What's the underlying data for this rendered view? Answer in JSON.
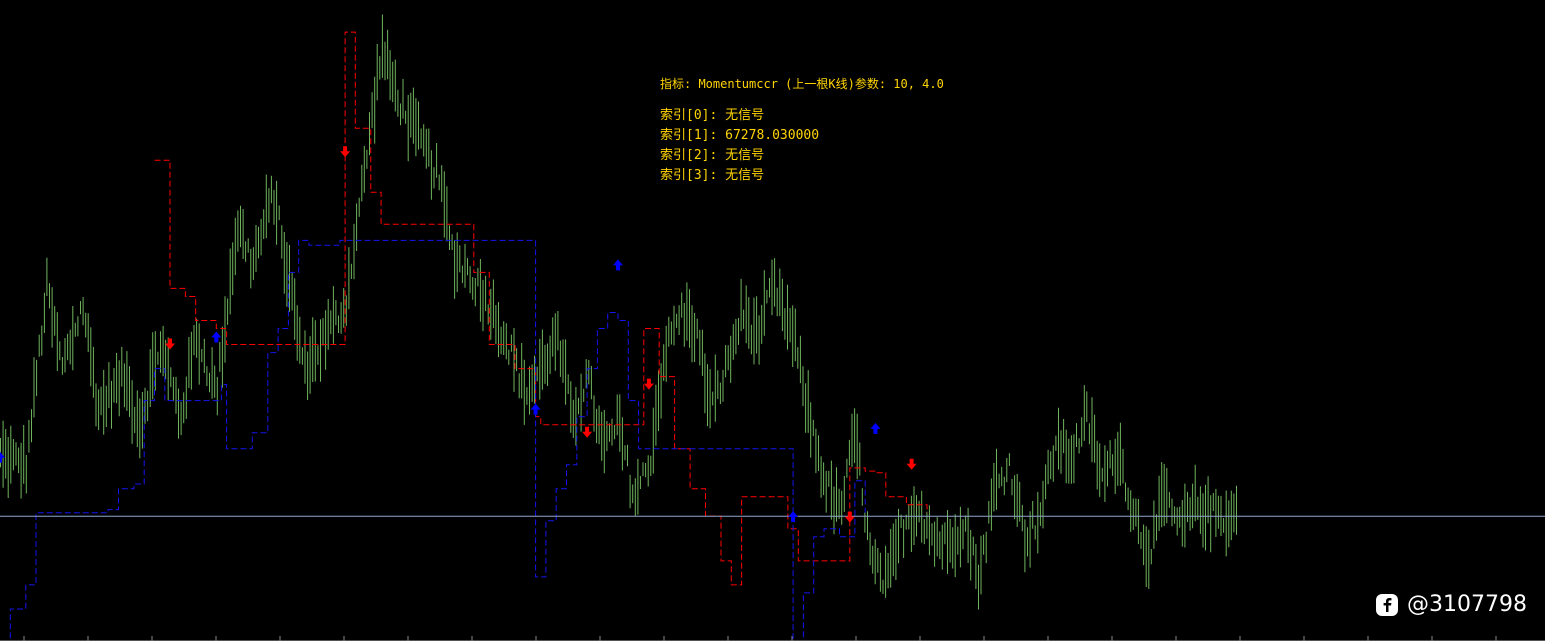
{
  "chart_data": {
    "type": "candlestick",
    "indicator_header": "指标: Momentumccr (上一根K线)参数: 10, 4.0",
    "buffers": [
      "索引[0]: 无信号",
      "索引[1]: 67278.030000",
      "索引[2]: 无信号",
      "索引[3]: 无信号"
    ],
    "horizontal_line": 67278.03,
    "ylim": [
      66500,
      70500
    ],
    "xlim": [
      0,
      240
    ],
    "price_anchors": [
      [
        0,
        67650
      ],
      [
        5,
        67600
      ],
      [
        9,
        68700
      ],
      [
        12,
        68200
      ],
      [
        16,
        68600
      ],
      [
        19,
        67950
      ],
      [
        24,
        68150
      ],
      [
        27,
        67850
      ],
      [
        31,
        68350
      ],
      [
        35,
        67900
      ],
      [
        38,
        68400
      ],
      [
        42,
        68050
      ],
      [
        46,
        69100
      ],
      [
        49,
        68850
      ],
      [
        53,
        69300
      ],
      [
        56,
        68750
      ],
      [
        59,
        68200
      ],
      [
        63,
        68400
      ],
      [
        67,
        68600
      ],
      [
        71,
        69500
      ],
      [
        74,
        70200
      ],
      [
        77,
        69900
      ],
      [
        81,
        69650
      ],
      [
        85,
        69400
      ],
      [
        88,
        68900
      ],
      [
        91,
        68800
      ],
      [
        95,
        68600
      ],
      [
        98,
        68400
      ],
      [
        102,
        68050
      ],
      [
        105,
        68200
      ],
      [
        108,
        68400
      ],
      [
        111,
        67900
      ],
      [
        114,
        68150
      ],
      [
        117,
        67700
      ],
      [
        120,
        67850
      ],
      [
        123,
        67400
      ],
      [
        126,
        67600
      ],
      [
        129,
        68300
      ],
      [
        132,
        68550
      ],
      [
        135,
        68450
      ],
      [
        138,
        67950
      ],
      [
        141,
        68200
      ],
      [
        144,
        68550
      ],
      [
        147,
        68400
      ],
      [
        150,
        68700
      ],
      [
        154,
        68400
      ],
      [
        157,
        67900
      ],
      [
        160,
        67500
      ],
      [
        163,
        67300
      ],
      [
        166,
        67800
      ],
      [
        169,
        67000
      ],
      [
        172,
        66850
      ],
      [
        175,
        67200
      ],
      [
        178,
        67350
      ],
      [
        181,
        67150
      ],
      [
        184,
        67100
      ],
      [
        187,
        67250
      ],
      [
        190,
        66900
      ],
      [
        193,
        67450
      ],
      [
        196,
        67600
      ],
      [
        199,
        67150
      ],
      [
        202,
        67300
      ],
      [
        205,
        67750
      ],
      [
        208,
        67650
      ],
      [
        211,
        67900
      ],
      [
        214,
        67500
      ],
      [
        217,
        67700
      ],
      [
        220,
        67300
      ],
      [
        223,
        67050
      ],
      [
        226,
        67400
      ],
      [
        229,
        67200
      ],
      [
        232,
        67350
      ],
      [
        235,
        67300
      ],
      [
        238,
        67280
      ],
      [
        240,
        67280
      ]
    ],
    "upper_stop": [
      [
        30,
        69500
      ],
      [
        33,
        68700
      ],
      [
        36,
        68650
      ],
      [
        38,
        68500
      ],
      [
        42,
        68450
      ],
      [
        44,
        68350
      ],
      [
        67,
        70300
      ],
      [
        69,
        69700
      ],
      [
        72,
        69300
      ],
      [
        74,
        69100
      ],
      [
        89,
        69100
      ],
      [
        92,
        68800
      ],
      [
        95,
        68350
      ],
      [
        100,
        68200
      ],
      [
        104,
        67900
      ],
      [
        105,
        67850
      ],
      [
        125,
        68450
      ],
      [
        128,
        68150
      ],
      [
        131,
        67700
      ],
      [
        134,
        67450
      ],
      [
        137,
        67280
      ],
      [
        140,
        67000
      ],
      [
        142,
        66850
      ],
      [
        144,
        67400
      ],
      [
        153,
        67200
      ],
      [
        155,
        67000
      ],
      [
        165,
        67580
      ],
      [
        168,
        67560
      ],
      [
        170,
        67550
      ],
      [
        172,
        67400
      ],
      [
        176,
        67350
      ],
      [
        180,
        67300
      ]
    ],
    "lower_stop": [
      [
        0,
        66300
      ],
      [
        2,
        66700
      ],
      [
        5,
        66850
      ],
      [
        7,
        67300
      ],
      [
        21,
        67320
      ],
      [
        23,
        67450
      ],
      [
        26,
        67480
      ],
      [
        28,
        68000
      ],
      [
        30,
        68200
      ],
      [
        32,
        68000
      ],
      [
        42,
        68000
      ],
      [
        43,
        68100
      ],
      [
        44,
        67700
      ],
      [
        49,
        67800
      ],
      [
        52,
        68300
      ],
      [
        54,
        68450
      ],
      [
        56,
        68800
      ],
      [
        58,
        69000
      ],
      [
        60,
        68970
      ],
      [
        66,
        69000
      ],
      [
        104,
        66900
      ],
      [
        106,
        67250
      ],
      [
        108,
        67450
      ],
      [
        110,
        67600
      ],
      [
        112,
        67900
      ],
      [
        114,
        68200
      ],
      [
        116,
        68450
      ],
      [
        118,
        68550
      ],
      [
        120,
        68500
      ],
      [
        122,
        68000
      ],
      [
        124,
        67700
      ],
      [
        154,
        66400
      ],
      [
        156,
        66800
      ],
      [
        158,
        67150
      ],
      [
        160,
        67200
      ],
      [
        163,
        67150
      ],
      [
        166,
        67500
      ],
      [
        168,
        67300
      ]
    ],
    "sell_signals": [
      [
        33,
        68350
      ],
      [
        67,
        69550
      ],
      [
        114,
        67800
      ],
      [
        126,
        68100
      ],
      [
        165,
        67270
      ],
      [
        177,
        67600
      ]
    ],
    "buy_signals": [
      [
        0,
        67650
      ],
      [
        42,
        68400
      ],
      [
        104,
        67950
      ],
      [
        120,
        68850
      ],
      [
        154,
        67280
      ],
      [
        170,
        67830
      ]
    ],
    "colors": {
      "background": "#000000",
      "bars": "#6fb45c",
      "upper_stop": "#ff0000",
      "lower_stop": "#1515ee",
      "sell_arrow": "#ff0000",
      "buy_arrow": "#0000ff",
      "horizontal_line": "#8fa8cc",
      "text": "#ffd400"
    }
  },
  "watermark": {
    "icon": "fb-logo-icon",
    "handle": "@3107798"
  }
}
